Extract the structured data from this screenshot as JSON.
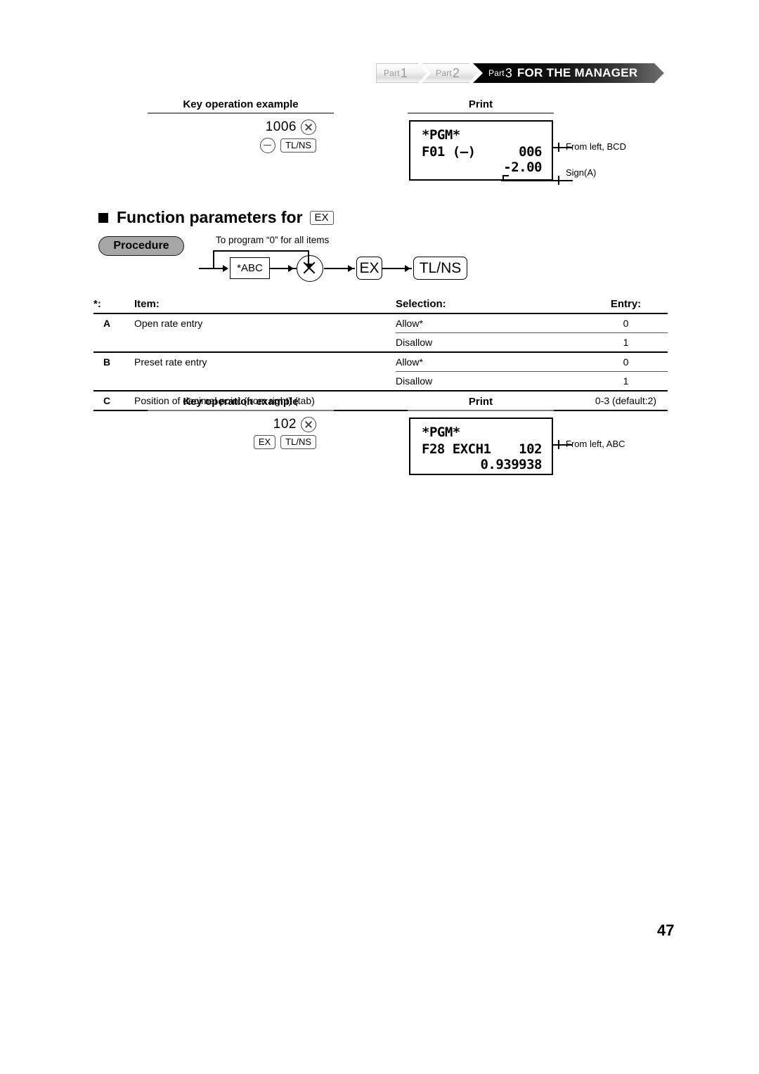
{
  "banner": {
    "parts": [
      {
        "label": "Part",
        "num": "1"
      },
      {
        "label": "Part",
        "num": "2"
      },
      {
        "label": "Part",
        "num": "3"
      }
    ],
    "title": "FOR THE MANAGER"
  },
  "section_top": {
    "keyops_header": "Key operation example",
    "print_header": "Print",
    "keys": {
      "entry": "1006",
      "multiply_icon": "circle-x-icon",
      "minus_icon": "circle-minus-icon",
      "total_key": "TL/NS"
    },
    "print": {
      "line1": "*PGM*",
      "line2_left": "F01 (—)",
      "line2_right": "006",
      "line3": "-2.00"
    },
    "annotations": [
      "From left, BCD",
      "Sign(A)"
    ]
  },
  "heading": {
    "bullet": "square-bullet-icon",
    "text": "Function parameters for",
    "key": "EX"
  },
  "procedure": {
    "badge": "Procedure",
    "note": "To program “0” for all items",
    "steps": [
      {
        "label": "*ABC",
        "shape": "rect"
      },
      {
        "label": "multiply-circle-icon",
        "shape": "circle"
      },
      {
        "label": "EX",
        "shape": "round"
      },
      {
        "label": "TL/NS",
        "shape": "round"
      }
    ]
  },
  "table": {
    "headers": {
      "star": "*:",
      "item": "Item:",
      "selection": "Selection:",
      "entry": "Entry:"
    },
    "rows": [
      {
        "letter": "A",
        "item": "Open rate entry",
        "selection": "Allow*",
        "entry": "0"
      },
      {
        "letter": "",
        "item": "",
        "selection": "Disallow",
        "entry": "1"
      },
      {
        "letter": "B",
        "item": "Preset rate entry",
        "selection": "Allow*",
        "entry": "0"
      },
      {
        "letter": "",
        "item": "",
        "selection": "Disallow",
        "entry": "1"
      },
      {
        "letter": "C",
        "item": "Position of decimal point (from right) (tab)",
        "selection": "",
        "entry": "0-3 (default:2)"
      }
    ]
  },
  "section_bottom": {
    "keyops_header": "Key operation example",
    "print_header": "Print",
    "keys": {
      "entry": "102",
      "multiply_icon": "circle-x-icon",
      "ex_key": "EX",
      "total_key": "TL/NS"
    },
    "print": {
      "line1": "*PGM*",
      "line2_left": "F28 EXCH1",
      "line2_right": "102",
      "line3": "0.939938"
    },
    "annotations": [
      "From left, ABC"
    ]
  },
  "page_number": "47"
}
